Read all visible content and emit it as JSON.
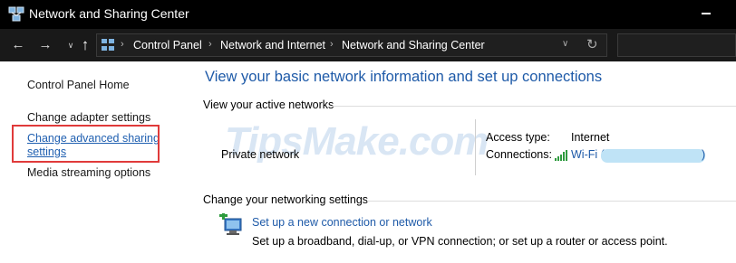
{
  "window": {
    "title": "Network and Sharing Center",
    "icon": "network-sharing-center-icon"
  },
  "address_bar": {
    "icon": "control-panel-icon",
    "breadcrumbs": [
      "Control Panel",
      "Network and Internet",
      "Network and Sharing Center"
    ],
    "nav_icons": {
      "back": "arrow-left-icon",
      "forward": "arrow-right-icon",
      "recent": "chevron-down-icon",
      "up": "arrow-up-icon",
      "refresh": "refresh-icon"
    }
  },
  "sidebar": {
    "items": [
      {
        "label": "Control Panel Home"
      },
      {
        "label": "Change adapter settings"
      },
      {
        "label_line1": "Change advanced sharing",
        "label_line2": "settings"
      },
      {
        "label": "Media streaming options"
      }
    ],
    "highlight_color": "#e03a3a"
  },
  "main": {
    "heading": "View your basic network information and set up connections",
    "active_networks": {
      "section_label": "View your active networks",
      "network_name": "Private network",
      "access_type_label": "Access type:",
      "access_type_value": "Internet",
      "connections_label": "Connections:",
      "connection_link": "Wi-Fi (",
      "connection_link_close": ")"
    },
    "change_settings": {
      "section_label": "Change your networking settings",
      "setup_link": "Set up a new connection or network",
      "setup_desc": "Set up a broadband, dial-up, or VPN connection; or set up a router or access point."
    },
    "watermark": "TipsMake.com"
  },
  "colors": {
    "link": "#1e5aa8",
    "titlebar_bg": "#000000",
    "addressbar_bg": "#191919"
  }
}
